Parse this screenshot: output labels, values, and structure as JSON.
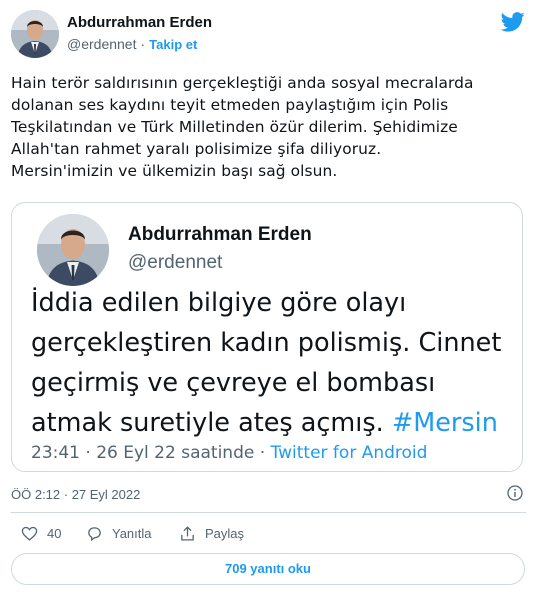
{
  "author": {
    "name": "Abdurrahman Erden",
    "handle": "@erdennet",
    "separator": "·",
    "follow_label": "Takip et"
  },
  "brand_icon": "twitter-bird-icon",
  "tweet_text": "Hain terör saldırısının gerçekleştiği anda sosyal mecralarda\ndolanan ses kaydını teyit etmeden paylaştığım için Polis\nTeşkilatından ve Türk Milletinden  özür dilerim. Şehidimize\nAllah'tan rahmet yaralı polisimize şifa diliyoruz.\nMersin'imizin ve ülkemizin başı sağ olsun.",
  "quoted": {
    "name": "Abdurrahman Erden",
    "handle": "@erdennet",
    "text_line1": "İddia edilen bilgiye göre olayı",
    "text_line2": "gerçekleştiren kadın polismiş. Cinnet",
    "text_line3": "geçirmiş ve çevreye el bombası",
    "text_line4": "atmak suretiyle ateş açmış.",
    "hashtag": "#Mersin",
    "time": "23:41",
    "date": "26 Eyl 22 saatinde",
    "separator": "·",
    "app": "Twitter for Android"
  },
  "timestamp": "ÖÖ 2:12 · 27 Eyl 2022",
  "actions": {
    "like_count": "40",
    "reply_label": "Yanıtla",
    "share_label": "Paylaş"
  },
  "read_replies_label": "709 yanıtı oku",
  "colors": {
    "accent": "#1d9bf0",
    "muted": "#536471",
    "border": "#cfd9de",
    "text": "#0f1419"
  }
}
